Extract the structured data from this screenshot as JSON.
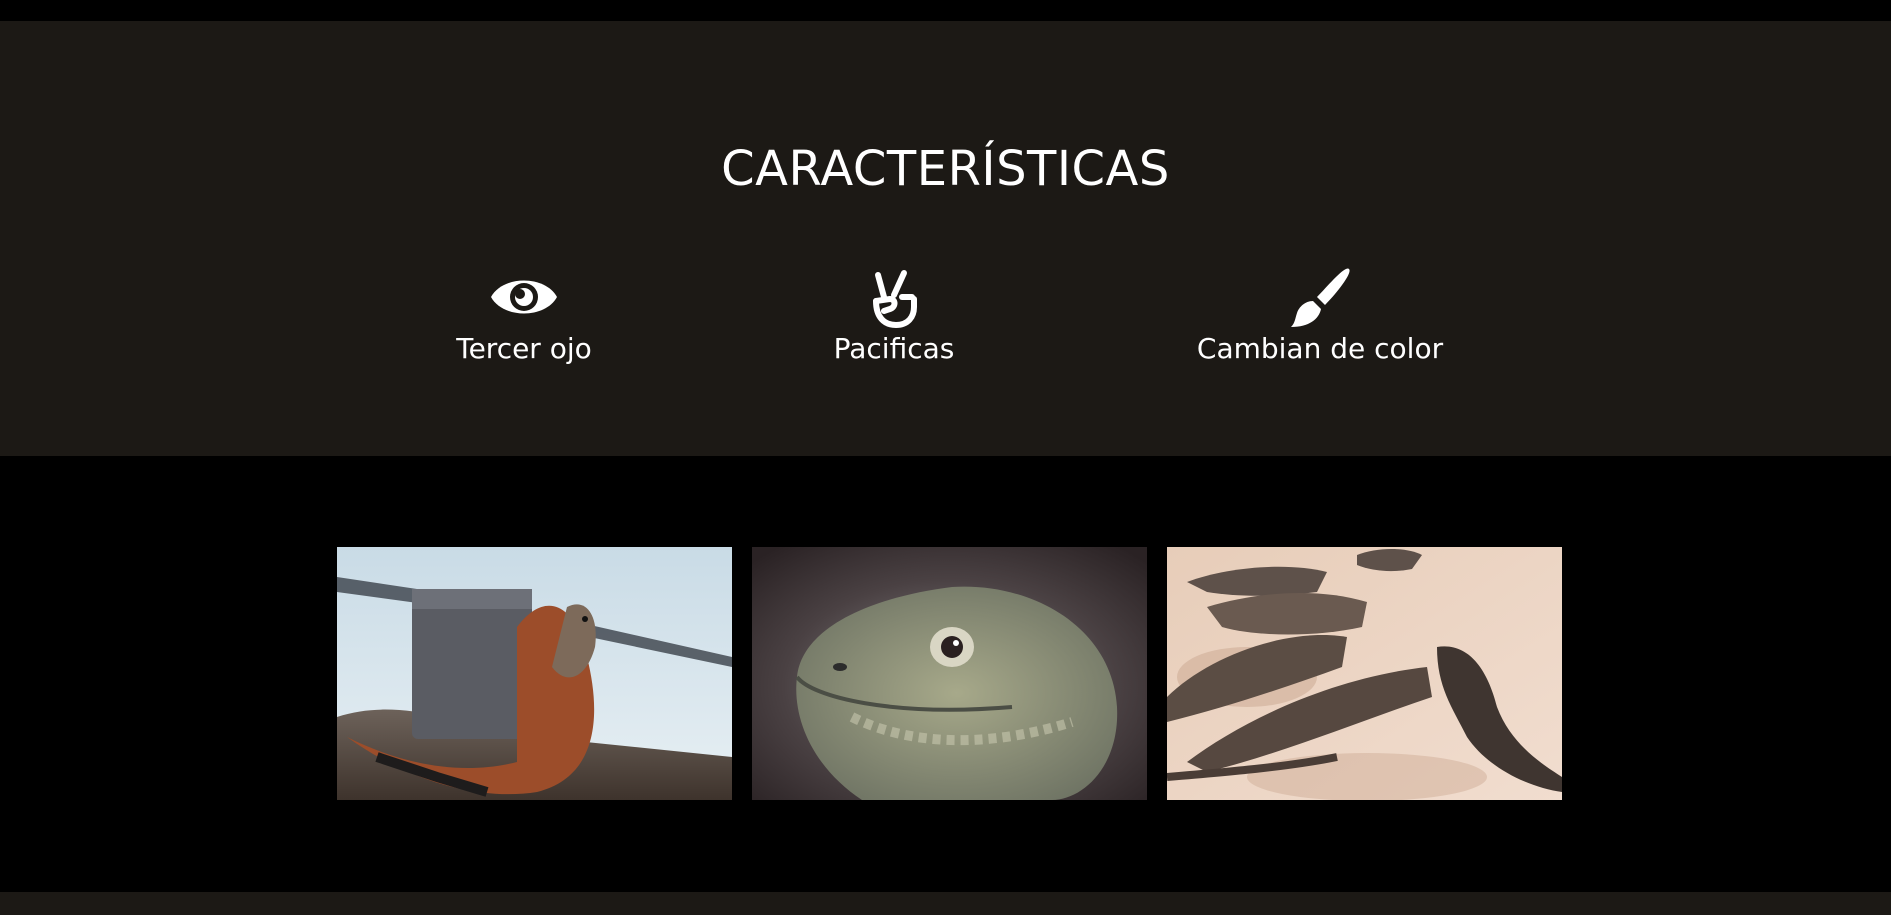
{
  "features": {
    "title": "CARACTERÍSTICAS",
    "items": [
      {
        "icon": "eye-icon",
        "label": "Tercer ojo"
      },
      {
        "icon": "peace-hand-icon",
        "label": "Pacificas"
      },
      {
        "icon": "paint-brush-icon",
        "label": "Cambian de color"
      }
    ]
  },
  "colors": {
    "section_background": "#1c1915",
    "page_background": "#000000",
    "text": "#ffffff"
  },
  "gallery": {
    "images": [
      {
        "subject": "iguana-by-water"
      },
      {
        "subject": "iguana-head-closeup"
      },
      {
        "subject": "iguanas-on-sand"
      }
    ]
  }
}
